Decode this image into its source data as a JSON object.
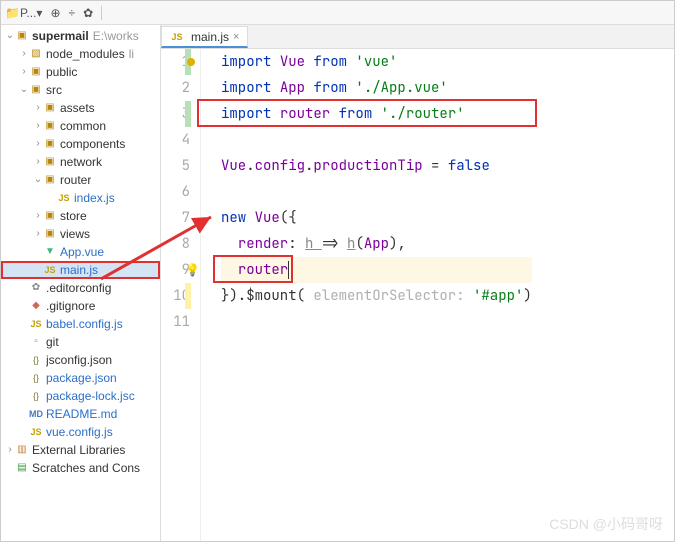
{
  "toolbar": {
    "project_short": "P...",
    "target_icon": "target",
    "plus_icon": "plus",
    "settings_icon": "gear",
    "sep": "|"
  },
  "tab": {
    "filename": "main.js",
    "icon": "JS",
    "close": "×"
  },
  "gutter": [
    "1",
    "2",
    "3",
    "4",
    "5",
    "6",
    "7",
    "8",
    "9",
    "10",
    "11"
  ],
  "code": {
    "line1": {
      "k": "import ",
      "id": "Vue ",
      "from": "from ",
      "str": "'vue'"
    },
    "line2": {
      "k": "import ",
      "id": "App ",
      "from": "from ",
      "str": "'./App.vue'"
    },
    "line3": {
      "k": "import ",
      "id": "router ",
      "from": "from ",
      "str": "'./router'"
    },
    "line5": {
      "obj": "Vue",
      "dot1": ".",
      "cfg": "config",
      "dot2": ".",
      "prop": "productionTip ",
      "eq": "= ",
      "val": "false"
    },
    "line7": {
      "k": "new ",
      "obj": "Vue",
      "paren": "({"
    },
    "line8": {
      "indent": "  ",
      "key": "render",
      "colon": ": ",
      "param": "h ",
      "arrow": "=> ",
      "fn": "h",
      "open": "(",
      "arg": "App",
      "close": "),"
    },
    "line9": {
      "indent": "  ",
      "val": "router"
    },
    "line10": {
      "close": "}).$mount(",
      "hint": " elementOrSelector: ",
      "str": "'#app'",
      "end": ")"
    }
  },
  "tree": {
    "root": {
      "label": "supermail",
      "extra": "E:\\works"
    },
    "node_modules": "node_modules",
    "node_modules_extra": "li",
    "public": "public",
    "src": "src",
    "assets": "assets",
    "common": "common",
    "components": "components",
    "network": "network",
    "router": "router",
    "index_js": "index.js",
    "store": "store",
    "views": "views",
    "app_vue": "App.vue",
    "main_js": "main.js",
    "editorconfig": ".editorconfig",
    "gitignore": ".gitignore",
    "babel": "babel.config.js",
    "git": "git",
    "jsconfig": "jsconfig.json",
    "package": "package.json",
    "package_lock": "package-lock.jsc",
    "readme": "README.md",
    "vue_config": "vue.config.js",
    "ext_lib": "External Libraries",
    "scratches": "Scratches and Cons"
  },
  "watermark": "CSDN @小码哥呀"
}
